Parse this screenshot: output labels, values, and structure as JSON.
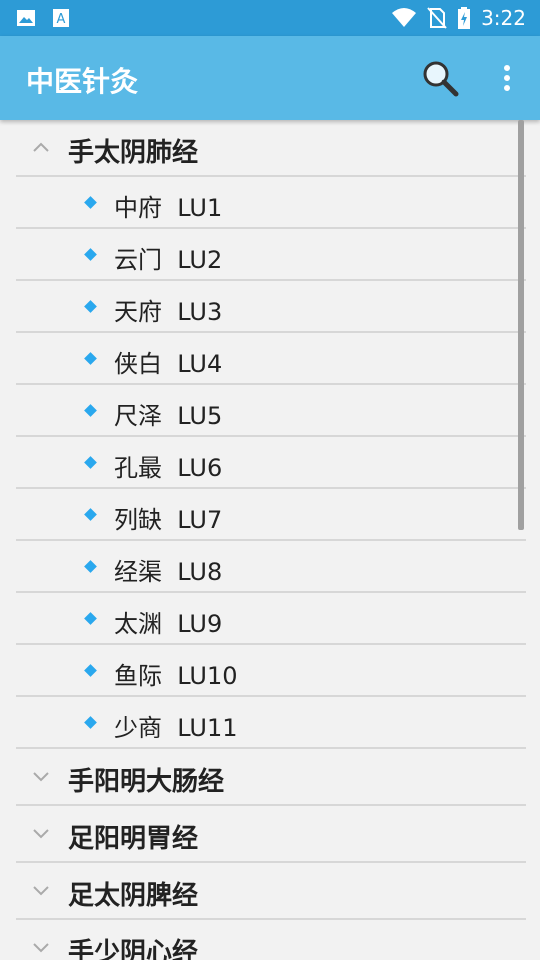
{
  "statusbar": {
    "left_icons": [
      "image-icon",
      "text-a-icon"
    ],
    "right_icons": [
      "wifi-icon",
      "no-sim-icon",
      "battery-charging-icon"
    ],
    "time": "3:22"
  },
  "appbar": {
    "title": "中医针灸",
    "actions": [
      "search-icon",
      "more-vert-icon"
    ]
  },
  "groups": [
    {
      "title": "手太阴肺经",
      "expanded": true,
      "items": [
        "中府  LU1",
        "云门  LU2",
        "天府  LU3",
        "侠白  LU4",
        "尺泽  LU5",
        "孔最  LU6",
        "列缺  LU7",
        "经渠  LU8",
        "太渊  LU9",
        "鱼际  LU10",
        "少商  LU11"
      ]
    },
    {
      "title": "手阳明大肠经",
      "expanded": false
    },
    {
      "title": "足阳明胃经",
      "expanded": false
    },
    {
      "title": "足太阴脾经",
      "expanded": false
    },
    {
      "title": "手少阴心经",
      "expanded": false
    }
  ],
  "colors": {
    "statusbar": "#2d9bd6",
    "appbar": "#59b9e6",
    "accent": "#2aa8ee"
  }
}
